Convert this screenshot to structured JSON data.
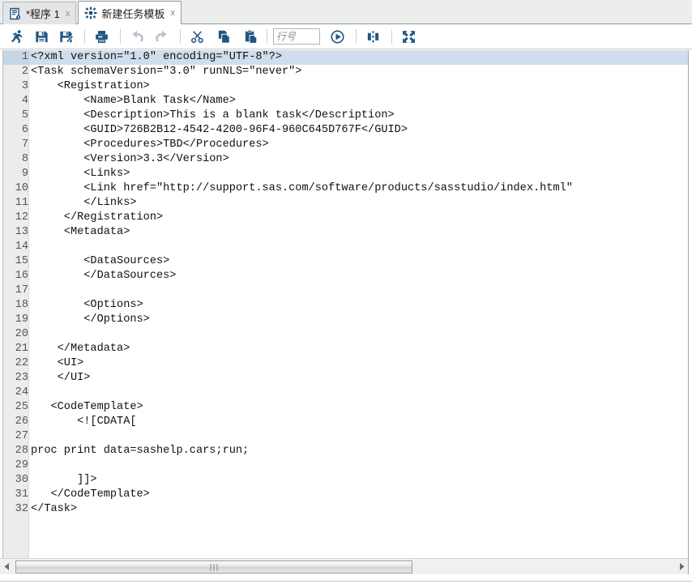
{
  "window": {
    "tabs": [
      {
        "label": "*程序 1",
        "icon": "program-document-icon",
        "close": "x",
        "active": false
      },
      {
        "label": "新建任务模板",
        "icon": "task-template-icon",
        "close": "x",
        "active": true
      }
    ]
  },
  "toolbar": {
    "buttons": [
      {
        "name": "run-button",
        "title": "运行",
        "icon": "running-person-icon",
        "enabled": true
      },
      {
        "name": "save-button",
        "title": "保存",
        "icon": "floppy-disk-icon",
        "enabled": true
      },
      {
        "name": "save-as-button",
        "title": "另存为",
        "icon": "floppy-disk-pen-icon",
        "enabled": true
      },
      {
        "name": "print-button",
        "title": "打印",
        "icon": "printer-icon",
        "enabled": true
      },
      {
        "name": "undo-button",
        "title": "撤消",
        "icon": "undo-arrow-icon",
        "enabled": false
      },
      {
        "name": "redo-button",
        "title": "重做",
        "icon": "redo-arrow-icon",
        "enabled": false
      },
      {
        "name": "cut-button",
        "title": "剪切",
        "icon": "scissors-icon",
        "enabled": true
      },
      {
        "name": "copy-button",
        "title": "复制",
        "icon": "copy-pages-icon",
        "enabled": true
      },
      {
        "name": "paste-button",
        "title": "粘贴",
        "icon": "clipboard-paste-icon",
        "enabled": true
      },
      {
        "name": "goto-line-button",
        "title": "转到行",
        "icon": "play-circle-icon",
        "enabled": true
      },
      {
        "name": "compare-button",
        "title": "比较",
        "icon": "compare-columns-icon",
        "enabled": true
      },
      {
        "name": "maximize-button",
        "title": "最大化视图",
        "icon": "expand-arrows-icon",
        "enabled": true
      }
    ],
    "line_number_input": {
      "name": "line-number-input",
      "value": "",
      "placeholder": "行号"
    }
  },
  "editor": {
    "highlighted_line": 1,
    "lines": [
      {
        "n": "1",
        "text": "<?xml version=\"1.0\" encoding=\"UTF-8\"?>"
      },
      {
        "n": "2",
        "text": "<Task schemaVersion=\"3.0\" runNLS=\"never\">"
      },
      {
        "n": "3",
        "text": "    <Registration>"
      },
      {
        "n": "4",
        "text": "        <Name>Blank Task</Name>"
      },
      {
        "n": "5",
        "text": "        <Description>This is a blank task</Description>"
      },
      {
        "n": "6",
        "text": "        <GUID>726B2B12-4542-4200-96F4-960C645D767F</GUID>"
      },
      {
        "n": "7",
        "text": "        <Procedures>TBD</Procedures>"
      },
      {
        "n": "8",
        "text": "        <Version>3.3</Version>"
      },
      {
        "n": "9",
        "text": "        <Links>"
      },
      {
        "n": "10",
        "text": "        <Link href=\"http://support.sas.com/software/products/sasstudio/index.html\""
      },
      {
        "n": "11",
        "text": "        </Links>"
      },
      {
        "n": "12",
        "text": "     </Registration>"
      },
      {
        "n": "13",
        "text": "     <Metadata>"
      },
      {
        "n": "14",
        "text": ""
      },
      {
        "n": "15",
        "text": "        <DataSources>"
      },
      {
        "n": "16",
        "text": "        </DataSources>"
      },
      {
        "n": "17",
        "text": ""
      },
      {
        "n": "18",
        "text": "        <Options>"
      },
      {
        "n": "19",
        "text": "        </Options>"
      },
      {
        "n": "20",
        "text": ""
      },
      {
        "n": "21",
        "text": "    </Metadata>"
      },
      {
        "n": "22",
        "text": "    <UI>"
      },
      {
        "n": "23",
        "text": "    </UI>"
      },
      {
        "n": "24",
        "text": ""
      },
      {
        "n": "25",
        "text": "   <CodeTemplate>"
      },
      {
        "n": "26",
        "text": "       <![CDATA["
      },
      {
        "n": "27",
        "text": ""
      },
      {
        "n": "28",
        "text": "proc print data=sashelp.cars;run;"
      },
      {
        "n": "29",
        "text": ""
      },
      {
        "n": "30",
        "text": "       ]]>"
      },
      {
        "n": "31",
        "text": "   </CodeTemplate>"
      },
      {
        "n": "32",
        "text": "</Task>"
      },
      {
        "n": "",
        "text": ""
      },
      {
        "n": "",
        "text": ""
      },
      {
        "n": "",
        "text": ""
      }
    ]
  },
  "scrollbar": {
    "left_arrow": "◀",
    "right_arrow": "▶",
    "thumb_grip": "|||"
  },
  "colors": {
    "accent": "#1f4e79",
    "tabbar_bg": "#eceded",
    "gutter_bg": "#ececec",
    "line_highlight": "#d0dded",
    "icon_blue": "#1f5582"
  }
}
